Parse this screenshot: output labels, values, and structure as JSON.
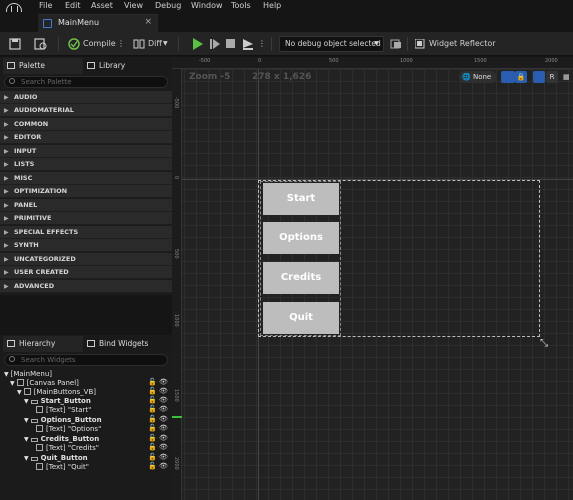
{
  "menubar": {
    "items": [
      "File",
      "Edit",
      "Asset",
      "View",
      "Debug",
      "Window",
      "Tools",
      "Help"
    ]
  },
  "tab": {
    "title": "MainMenu",
    "close": "×"
  },
  "toolbar": {
    "compile": "Compile",
    "diff": "Diff",
    "debug_object": "No debug object selected",
    "widget_reflector": "Widget Reflector"
  },
  "palette": {
    "tab_palette": "Palette",
    "tab_library": "Library",
    "search_placeholder": "Search Palette",
    "categories": [
      "AUDIO",
      "AUDIOMATERIAL",
      "COMMON",
      "EDITOR",
      "INPUT",
      "LISTS",
      "MISC",
      "OPTIMIZATION",
      "PANEL",
      "PRIMITIVE",
      "SPECIAL EFFECTS",
      "SYNTH",
      "UNCATEGORIZED",
      "USER CREATED",
      "ADVANCED"
    ]
  },
  "hierarchy": {
    "tab_hierarchy": "Hierarchy",
    "tab_bind": "Bind Widgets",
    "search_placeholder": "Search Widgets",
    "rows": [
      "[MainMenu]",
      "[Canvas Panel]",
      "[MainButtons_VB]",
      "Start_Button",
      "[Text] \"Start\"",
      "Options_Button",
      "[Text] \"Options\"",
      "Credits_Button",
      "[Text] \"Credits\"",
      "Quit_Button",
      "[Text] \"Quit\""
    ]
  },
  "canvas": {
    "zoom": "Zoom -5",
    "resolution": "278 x 1,626",
    "none_label": "None",
    "r_label": "R",
    "ruler_top": [
      "-500",
      "0",
      "500",
      "1000",
      "1500",
      "2000"
    ],
    "ruler_left": [
      "-500",
      "0",
      "500",
      "1000",
      "1500",
      "2000"
    ],
    "buttons": [
      "Start",
      "Options",
      "Credits",
      "Quit"
    ]
  }
}
